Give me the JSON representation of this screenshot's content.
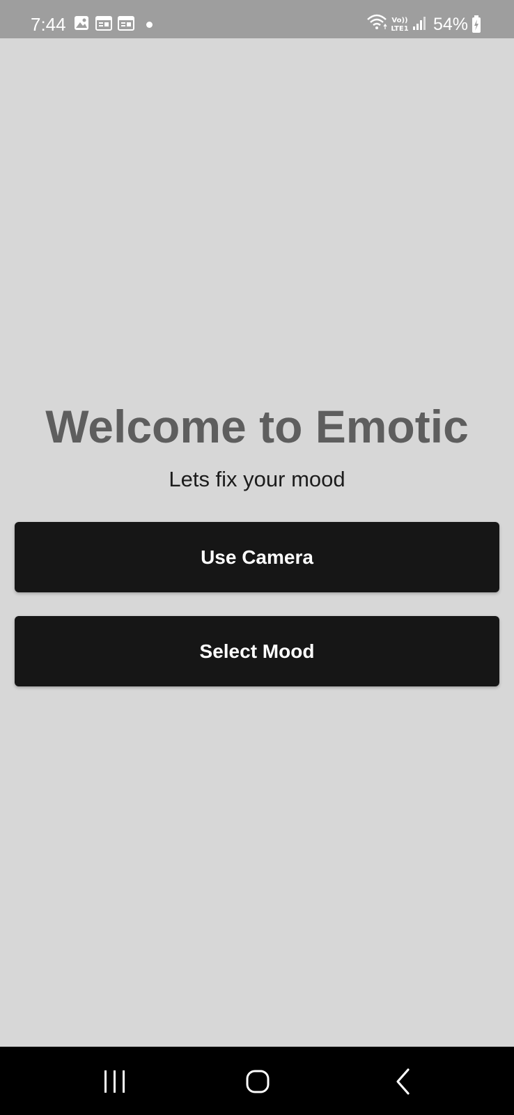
{
  "status_bar": {
    "time": "7:44",
    "battery": "54%",
    "network": "Vo)) LTE1",
    "icons": [
      "image-icon",
      "calendar-icon",
      "calendar-icon",
      "notification-dot",
      "wifi-icon",
      "signal-icon",
      "battery-charging-icon"
    ]
  },
  "main": {
    "title": "Welcome to Emotic",
    "subtitle": "Lets fix your mood",
    "use_camera_label": "Use Camera",
    "select_mood_label": "Select Mood"
  },
  "nav_bar": {
    "icons": [
      "recent-apps-icon",
      "home-icon",
      "back-icon"
    ]
  },
  "colors": {
    "background": "#d7d7d7",
    "status_bar": "#9e9e9e",
    "button": "#161616",
    "title": "#5e5e5e",
    "nav_bar": "#000000"
  }
}
